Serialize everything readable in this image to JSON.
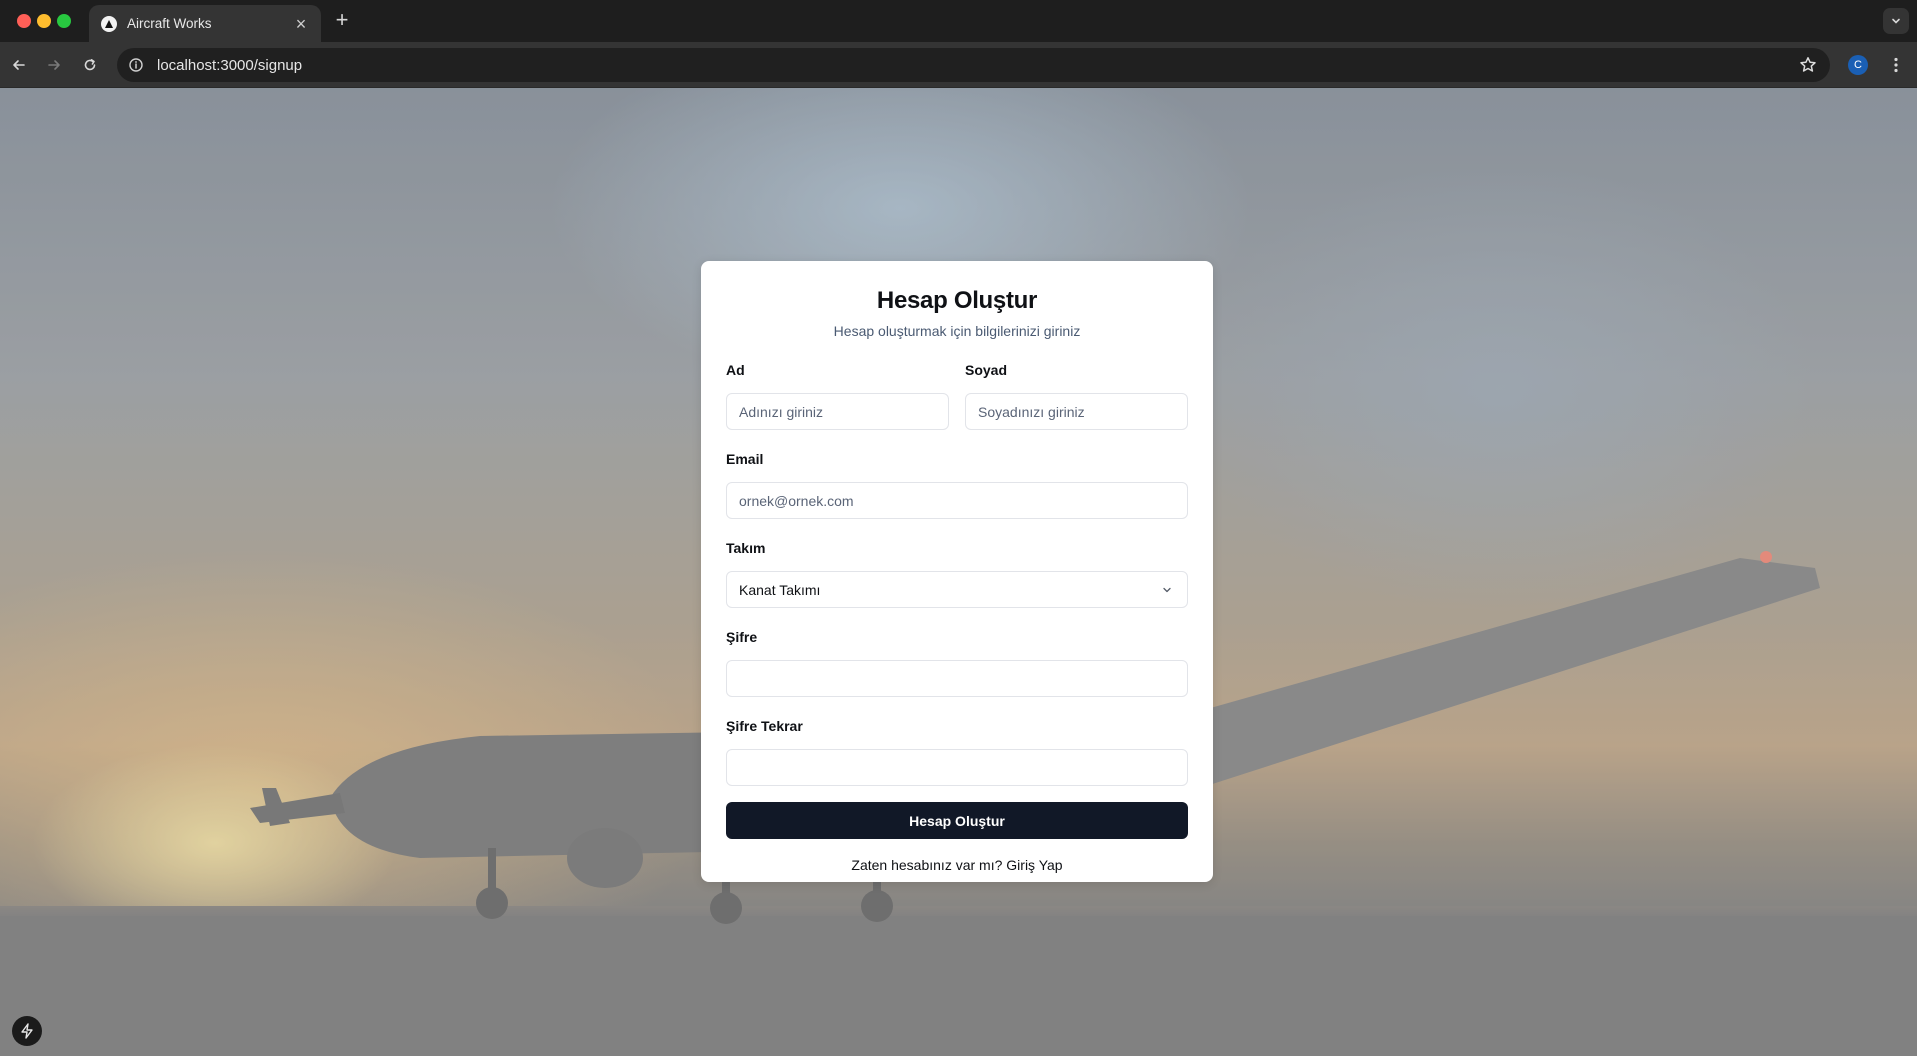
{
  "browser": {
    "tab_title": "Aircraft Works",
    "tab_close_glyph": "×",
    "new_tab_glyph": "+",
    "url": "localhost:3000/signup",
    "profile_initial": "C",
    "icons": [
      "back-arrow-icon",
      "forward-arrow-icon",
      "reload-icon",
      "site-info-icon",
      "bookmark-star-icon",
      "kebab-menu-icon",
      "tab-list-chevron-icon"
    ]
  },
  "background": {
    "description_colors": {
      "sky": "#a3a8ad",
      "sunset": "#c9ad8c",
      "ground": "#828282"
    }
  },
  "signup": {
    "title": "Hesap Oluştur",
    "subtitle": "Hesap oluşturmak için bilgilerinizi giriniz",
    "first_name": {
      "label": "Ad",
      "placeholder": "Adınızı giriniz",
      "value": ""
    },
    "last_name": {
      "label": "Soyad",
      "placeholder": "Soyadınızı giriniz",
      "value": ""
    },
    "email": {
      "label": "Email",
      "placeholder": "ornek@ornek.com",
      "value": ""
    },
    "team": {
      "label": "Takım",
      "selected": "Kanat Takımı"
    },
    "password": {
      "label": "Şifre",
      "value": ""
    },
    "password_confirm": {
      "label": "Şifre Tekrar",
      "value": ""
    },
    "submit_label": "Hesap Oluştur",
    "login_prompt": "Zaten hesabınız var mı?",
    "login_link": "Giriş Yap"
  },
  "colors": {
    "primary_button": "#111827",
    "card_bg": "#ffffff",
    "subtitle": "#4a5a72"
  }
}
